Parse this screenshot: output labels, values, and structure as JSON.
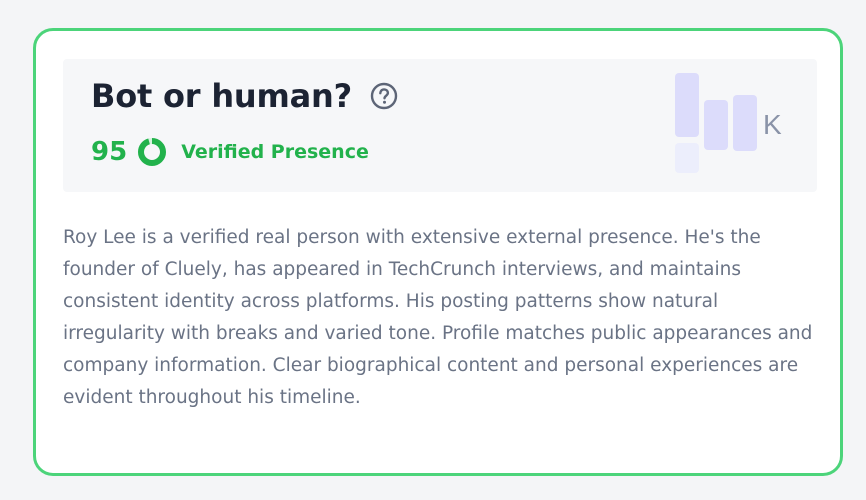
{
  "card": {
    "title": "Bot or human?",
    "score": {
      "value": "95",
      "fraction": 0.95,
      "label": "Verified Presence"
    },
    "logo_letter": "K",
    "summary": "Roy Lee is a verified real person with extensive external presence. He's the founder of Cluely, has appeared in TechCrunch interviews, and maintains consistent identity across platforms. His posting patterns show natural irregularity with breaks and varied tone. Profile matches public appearances and company information. Clear biographical content and personal experiences are evident throughout his timeline."
  },
  "icons": {
    "help": "question-circle-icon",
    "score_ring": "progress-ring-icon",
    "logo": "bar-logo-icon"
  },
  "colors": {
    "border": "#4cd47a",
    "accent_green": "#22b24c",
    "title": "#1c2333",
    "body_text": "#6a7385",
    "logo_bars": "#dcdcfb"
  }
}
